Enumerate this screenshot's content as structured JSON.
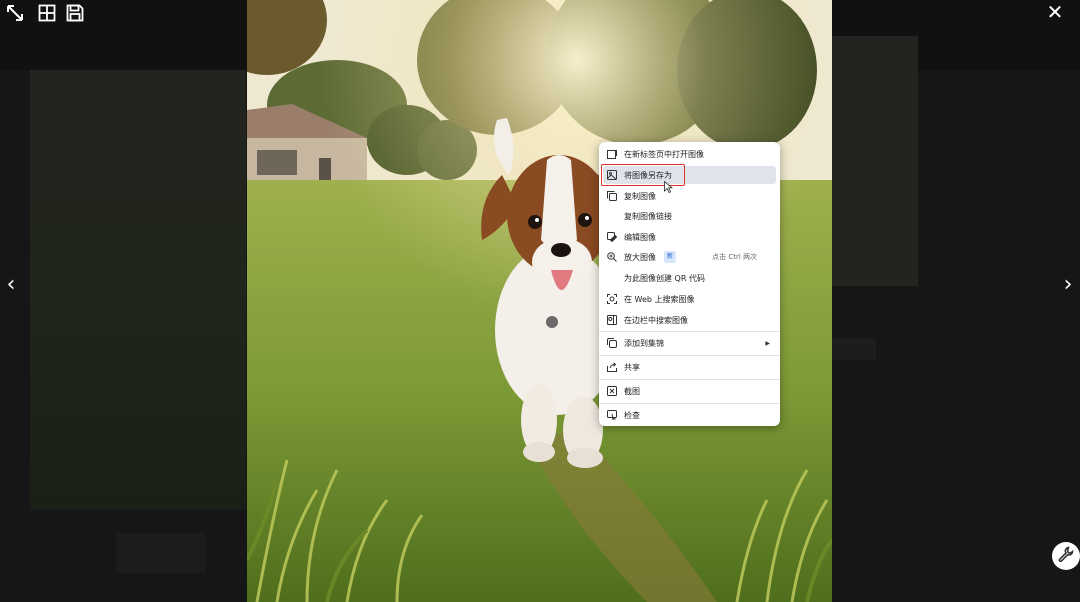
{
  "toolbar": {
    "icons": [
      "collapse-icon",
      "grid-layout-icon",
      "save-icon"
    ],
    "close_label": "✕"
  },
  "navigation": {
    "prev_label": "‹",
    "next_label": "›"
  },
  "context_menu": {
    "items": [
      {
        "label": "在新标签页中打开图像",
        "icon": "open-new-tab-icon"
      },
      {
        "label": "将图像另存为",
        "icon": "save-image-icon",
        "highlighted": true
      },
      {
        "label": "复制图像",
        "icon": "copy-image-icon"
      },
      {
        "label": "复制图像链接",
        "icon": ""
      },
      {
        "label": "编辑图像",
        "icon": "edit-image-icon"
      },
      {
        "label": "放大图像",
        "icon": "zoom-icon",
        "badge": "新",
        "shortcut": "点击 Ctrl 两次"
      },
      {
        "label": "为此图像创建 QR 代码",
        "icon": ""
      },
      {
        "label": "在 Web 上搜索图像",
        "icon": "web-search-icon"
      },
      {
        "label": "在边栏中搜索图像",
        "icon": "sidebar-search-icon"
      },
      {
        "label": "添加到集锦",
        "icon": "collections-icon",
        "submenu": true
      },
      {
        "label": "共享",
        "icon": "share-icon"
      },
      {
        "label": "截图",
        "icon": "screenshot-icon"
      },
      {
        "label": "检查",
        "icon": "inspect-icon"
      }
    ]
  },
  "colors": {
    "highlight_border": "#e0342a",
    "menu_hover": "#dfe4ec",
    "overlay": "#0d0d0d"
  }
}
